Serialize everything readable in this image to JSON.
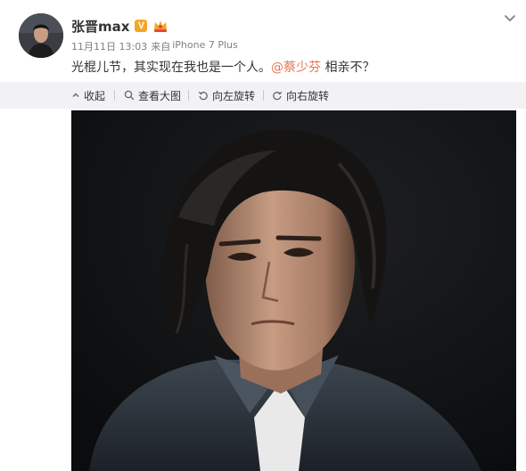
{
  "post": {
    "username": "张晋max",
    "verified_badge": "V",
    "badge_color": "#f5a623",
    "vip_icon": "vip-crown-icon",
    "timestamp": "11月11日 13:03",
    "source_prefix": "来自",
    "device": "iPhone 7 Plus",
    "text_before": "光棍儿节，其实现在我也是一个人。",
    "mention": "@蔡少芬",
    "text_after": " 相亲不？",
    "mention_color": "#eb7350"
  },
  "toolbar": {
    "background": "#f2f2f5",
    "collapse_label": "收起",
    "view_large_label": "查看大图",
    "rotate_left_label": "向左旋转",
    "rotate_right_label": "向右旋转"
  },
  "photo": {
    "icon": "portrait-photo"
  }
}
